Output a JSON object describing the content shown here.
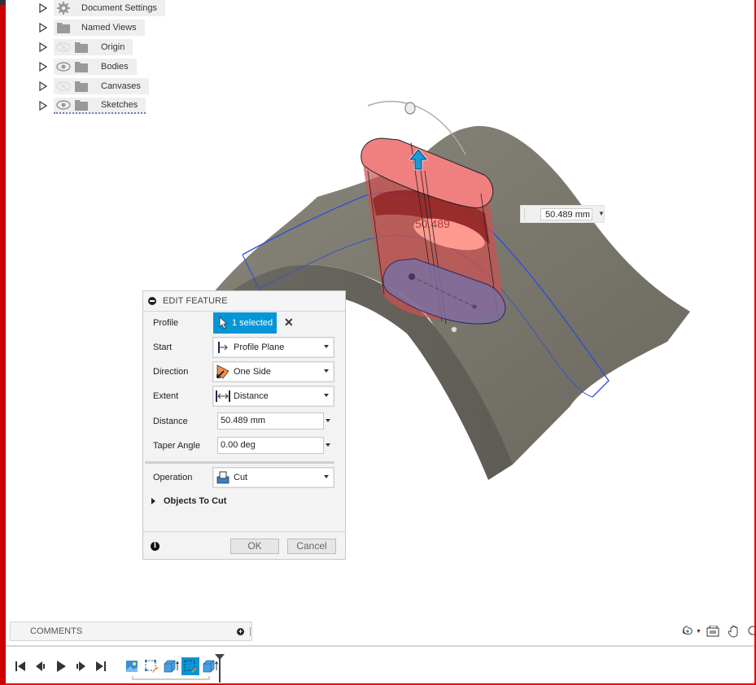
{
  "browser": {
    "items": [
      {
        "label": "Document Settings",
        "icon": "gear-icon",
        "visibility": "none"
      },
      {
        "label": "Named Views",
        "icon": "folder-icon",
        "visibility": "none"
      },
      {
        "label": "Origin",
        "icon": "folder-icon",
        "visibility": "hidden"
      },
      {
        "label": "Bodies",
        "icon": "folder-icon",
        "visibility": "visible"
      },
      {
        "label": "Canvases",
        "icon": "folder-icon",
        "visibility": "hidden"
      },
      {
        "label": "Sketches",
        "icon": "folder-icon",
        "visibility": "visible"
      }
    ]
  },
  "viewport": {
    "dimension_label": "50.489",
    "dimension_input": "50.489 mm"
  },
  "edit_feature": {
    "title": "EDIT FEATURE",
    "profile": {
      "label": "Profile",
      "value": "1 selected"
    },
    "start": {
      "label": "Start",
      "value": "Profile Plane"
    },
    "direction": {
      "label": "Direction",
      "value": "One Side"
    },
    "extent": {
      "label": "Extent",
      "value": "Distance"
    },
    "distance": {
      "label": "Distance",
      "value": "50.489 mm"
    },
    "taper_angle": {
      "label": "Taper Angle",
      "value": "0.00 deg"
    },
    "operation": {
      "label": "Operation",
      "value": "Cut"
    },
    "objects_to_cut": "Objects To Cut",
    "ok": "OK",
    "cancel": "Cancel"
  },
  "comments": {
    "label": "COMMENTS"
  },
  "colors": {
    "accent": "#0696d7",
    "body": "#77746a",
    "cut_preview": "#e06060",
    "sketch_line": "#2a4fd8"
  }
}
